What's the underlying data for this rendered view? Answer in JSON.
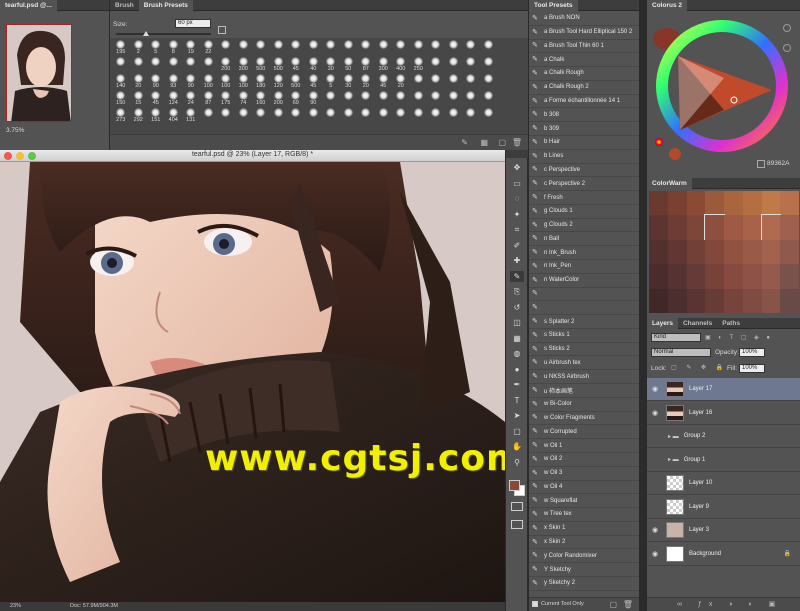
{
  "navigator": {
    "tab": "tearful.psd @...",
    "zoom": "3.75%"
  },
  "brush_panel": {
    "tabs": [
      "Brush",
      "Brush Presets"
    ],
    "size_label": "Size:",
    "size_value": "60 px",
    "rows": [
      [
        "195",
        "2",
        "5",
        "8",
        "19",
        "22",
        "",
        "",
        "",
        "",
        "",
        "",
        "",
        "",
        "",
        "",
        "",
        "",
        "",
        "",
        "",
        ""
      ],
      [
        "",
        "",
        "",
        "",
        "",
        "",
        "200",
        "300",
        "500",
        "500",
        "45",
        "40",
        "30",
        "50",
        "87",
        "300",
        "400",
        "250",
        "",
        "",
        "",
        ""
      ],
      [
        "140",
        "20",
        "90",
        "93",
        "90",
        "100",
        "100",
        "100",
        "180",
        "120",
        "500",
        "45",
        "5",
        "30",
        "20",
        "45",
        "20",
        "",
        "",
        "",
        "",
        ""
      ],
      [
        "150",
        "15",
        "45",
        "124",
        "24",
        "87",
        "175",
        "74",
        "160",
        "200",
        "69",
        "90",
        "",
        "",
        "",
        "",
        "",
        "",
        "",
        "",
        "",
        ""
      ],
      [
        "273",
        "292",
        "151",
        "404",
        "131",
        "",
        "",
        "",
        "",
        "",
        "",
        "",
        "",
        "",
        "",
        "",
        "",
        "",
        "",
        "",
        "",
        ""
      ]
    ]
  },
  "document": {
    "title": "tearful.psd @ 23% (Layer 17, RGB/8) *",
    "status_zoom": "23%",
    "status_doc": "Doc: 57.9M/904.3M",
    "watermark": "www.cgtsj.com"
  },
  "toolbar": {
    "tools": [
      "move-tool",
      "marquee-tool",
      "lasso-tool",
      "quick-select-tool",
      "crop-tool",
      "eyedropper-tool",
      "healing-tool",
      "brush-tool",
      "clone-stamp-tool",
      "history-brush-tool",
      "eraser-tool",
      "gradient-tool",
      "blur-tool",
      "dodge-tool",
      "pen-tool",
      "type-tool",
      "path-select-tool",
      "rectangle-tool",
      "hand-tool",
      "zoom-tool"
    ],
    "foreground_color": "#8a4a34",
    "background_color": "#ffffff"
  },
  "tool_presets": {
    "tab": "Tool Presets",
    "items": [
      "a Brush NON",
      "a Brush Tool Hard Elliptical 150 2",
      "a Brush Tool Thin 60 1",
      "a Chalk",
      "a Chalk Rough",
      "a Chalk Rough 2",
      "a Forme échantillonnée 14 1",
      "b 308",
      "b 309",
      "b Hair",
      "b Lines",
      "c Perspective",
      "c Perspective 2",
      "f Fresh",
      "g Clouds 1",
      "g Clouds 2",
      "n Ball",
      "n Ink_Brush",
      "n Ink_Pen",
      "n WaterColor",
      "",
      "",
      "s Splatter 2",
      "s Sticks 1",
      "s Sticks 2",
      "u Airbrush tex",
      "u NKSS Airbrush",
      "u 柿本画笔",
      "w Bi-Color",
      "w Color Fragments",
      "w Corrupted",
      "w Oil 1",
      "w Oil 2",
      "w Oil 3",
      "w Oil 4",
      "w Squareflat",
      "w Tree tex",
      "x Skin 1",
      "x Skin 2",
      "y Color Randomixer",
      "Y Sketchy",
      "y Sketchy 2"
    ],
    "footer": "Current Tool Only"
  },
  "colorus": {
    "tab": "Colorus 2",
    "hex": "89362A",
    "current_color": "#89362a",
    "previous_color": "#b04a2e"
  },
  "colorwarm": {
    "tab": "ColorWarm",
    "swatches": [
      "#6b3a2e",
      "#7a4030",
      "#8a4a34",
      "#9c5a3c",
      "#a8653e",
      "#b46e42",
      "#c07a48",
      "#b8714c",
      "#5e3430",
      "#6e3c34",
      "#7e4638",
      "#8e503e",
      "#9e5a44",
      "#a8624a",
      "#b06a50",
      "#a06050",
      "#52302e",
      "#623632",
      "#724036",
      "#82483c",
      "#925242",
      "#9a5a48",
      "#a2624e",
      "#8e5a4e",
      "#4a2c2c",
      "#563232",
      "#663a36",
      "#76423a",
      "#864a40",
      "#8e5246",
      "#965a4c",
      "#7a524c",
      "#402828",
      "#4c2e2e",
      "#5a3432",
      "#683c36",
      "#76443c",
      "#7e4c42",
      "#865448",
      "#6a4a46"
    ]
  },
  "layers": {
    "tabs": [
      "Layers",
      "Channels",
      "Paths"
    ],
    "kind_label": "Kind",
    "blend_mode": "Normal",
    "opacity_label": "Opacity:",
    "opacity_value": "100%",
    "lock_label": "Lock:",
    "fill_label": "Fill:",
    "fill_value": "100%",
    "items": [
      {
        "name": "Layer 17",
        "visible": true,
        "selected": true,
        "type": "layer"
      },
      {
        "name": "Layer 16",
        "visible": true,
        "selected": false,
        "type": "layer"
      },
      {
        "name": "Group 2",
        "visible": false,
        "selected": false,
        "type": "group"
      },
      {
        "name": "Group 1",
        "visible": false,
        "selected": false,
        "type": "group"
      },
      {
        "name": "Layer 10",
        "visible": false,
        "selected": false,
        "type": "layer"
      },
      {
        "name": "Layer 9",
        "visible": false,
        "selected": false,
        "type": "layer"
      },
      {
        "name": "Layer 3",
        "visible": true,
        "selected": false,
        "type": "layer"
      },
      {
        "name": "Background",
        "visible": true,
        "selected": false,
        "type": "background"
      }
    ]
  }
}
